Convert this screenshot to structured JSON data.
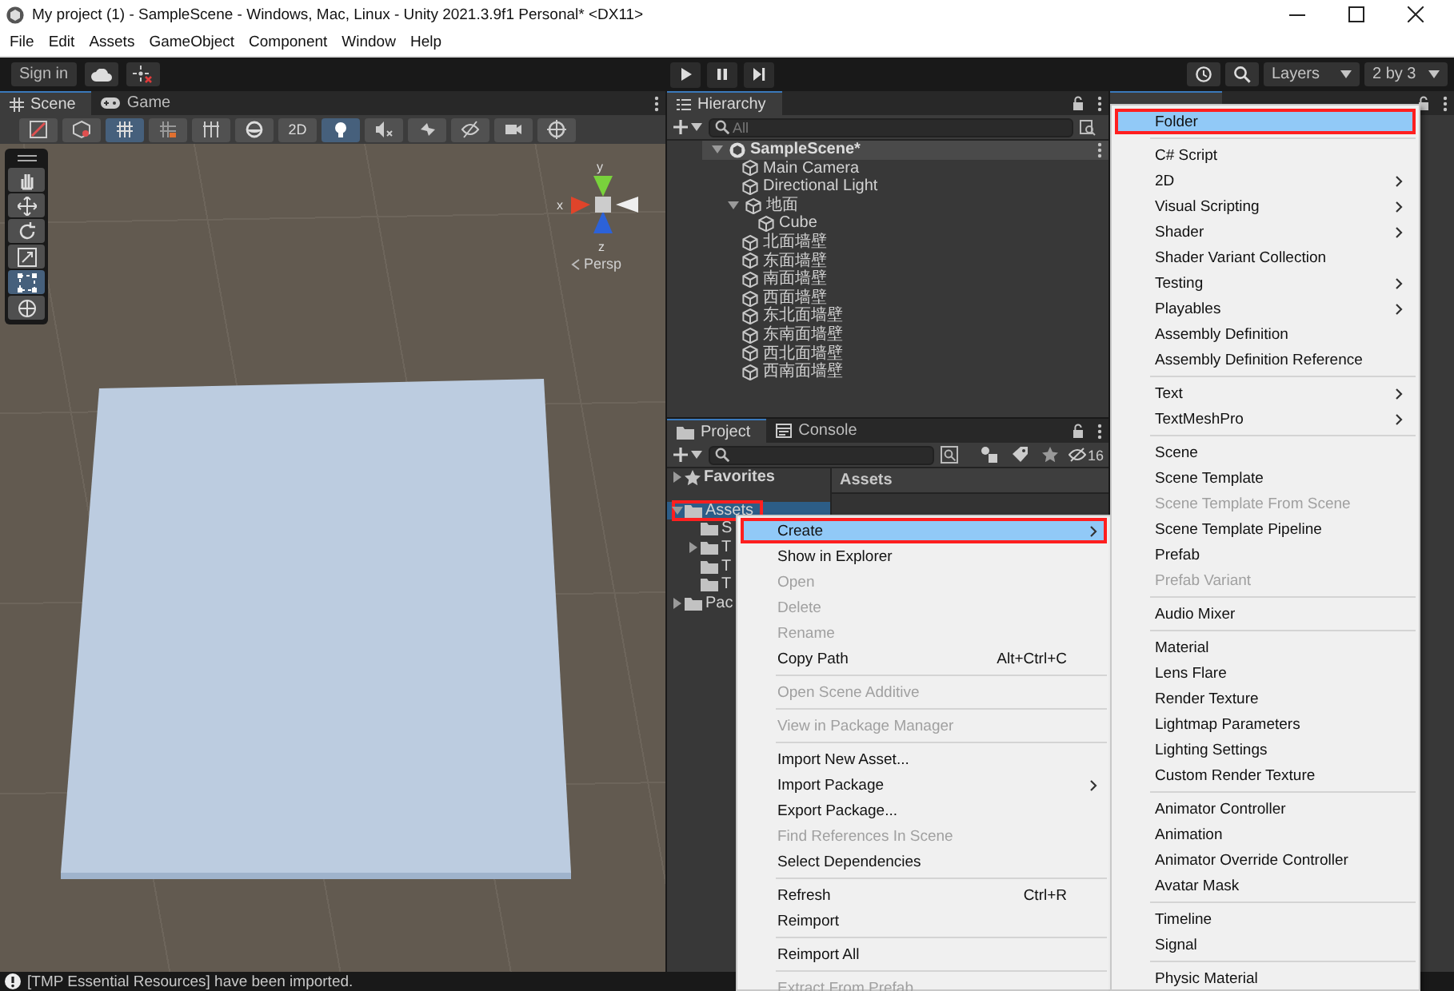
{
  "window": {
    "title": "My project (1) - SampleScene - Windows, Mac, Linux - Unity 2021.3.9f1 Personal* <DX11>"
  },
  "menu_bar": [
    "File",
    "Edit",
    "Assets",
    "GameObject",
    "Component",
    "Window",
    "Help"
  ],
  "toolbar": {
    "sign_in": "Sign in",
    "layers": "Layers",
    "layout": "2 by 3"
  },
  "scene_view": {
    "tabs": [
      {
        "label": "Scene",
        "kind": "scene",
        "selected": true
      },
      {
        "label": "Game",
        "kind": "game",
        "selected": false
      }
    ],
    "toggles": [
      {
        "kind": "draw-mode",
        "selected": false
      },
      {
        "kind": "render",
        "selected": false
      },
      {
        "kind": "grid",
        "selected": true
      },
      {
        "kind": "snap",
        "selected": false
      },
      {
        "kind": "increment",
        "selected": false
      },
      {
        "kind": "orbit",
        "selected": false
      },
      {
        "kind": "text",
        "label": "2D",
        "selected": false
      },
      {
        "kind": "light",
        "selected": true
      },
      {
        "kind": "audio",
        "selected": false
      },
      {
        "kind": "effects",
        "selected": false
      },
      {
        "kind": "hidden",
        "selected": false
      },
      {
        "kind": "camera",
        "selected": false
      },
      {
        "kind": "gizmos",
        "selected": false
      }
    ],
    "tools": [
      {
        "kind": "hand",
        "selected": false
      },
      {
        "kind": "move",
        "selected": false
      },
      {
        "kind": "rotate",
        "selected": false
      },
      {
        "kind": "scale",
        "selected": false
      },
      {
        "kind": "rect",
        "selected": true
      },
      {
        "kind": "transform",
        "selected": false
      }
    ],
    "gizmo": {
      "y": "y",
      "x": "x",
      "z": "z",
      "projection": "Persp"
    }
  },
  "hierarchy": {
    "title": "Hierarchy",
    "search_placeholder": "All",
    "scene": {
      "label": "SampleScene*",
      "expanded": true,
      "children": [
        {
          "label": "Main Camera"
        },
        {
          "label": "Directional Light"
        },
        {
          "label": "地面",
          "expanded": true,
          "children": [
            {
              "label": "Cube"
            }
          ]
        },
        {
          "label": "北面墙壁"
        },
        {
          "label": "东面墙壁"
        },
        {
          "label": "南面墙壁"
        },
        {
          "label": "西面墙壁"
        },
        {
          "label": "东北面墙壁"
        },
        {
          "label": "东南面墙壁"
        },
        {
          "label": "西北面墙壁"
        },
        {
          "label": "西南面墙壁"
        }
      ]
    }
  },
  "project": {
    "tabs": [
      {
        "label": "Project",
        "kind": "project",
        "selected": true
      },
      {
        "label": "Console",
        "kind": "console",
        "selected": false
      }
    ],
    "hidden_count": "16",
    "pane_header": "Assets",
    "tree": [
      {
        "label": "Favorites",
        "kind": "favorites",
        "expanded": false,
        "selected": false
      },
      {
        "label": "Assets",
        "kind": "folder",
        "expanded": true,
        "selected": true,
        "outlined": true,
        "children": [
          {
            "label": "S",
            "kind": "folder",
            "selected": false
          },
          {
            "label": "T",
            "kind": "folder",
            "expanded": false,
            "selected": false
          },
          {
            "label": "T",
            "kind": "folder",
            "selected": false
          },
          {
            "label": "T",
            "kind": "folder",
            "selected": false
          }
        ]
      },
      {
        "label": "Pac",
        "kind": "folder",
        "expanded": false,
        "selected": false
      }
    ]
  },
  "context_menu": {
    "items": [
      {
        "kind": "item",
        "label": "Create",
        "selected": true,
        "outlined": true,
        "submenu": true
      },
      {
        "kind": "item",
        "label": "Show in Explorer",
        "selected": false
      },
      {
        "kind": "item",
        "label": "Open",
        "selected": false,
        "disabled": true
      },
      {
        "kind": "item",
        "label": "Delete",
        "selected": false,
        "disabled": true
      },
      {
        "kind": "item",
        "label": "Rename",
        "selected": false,
        "disabled": true
      },
      {
        "kind": "item",
        "label": "Copy Path",
        "selected": false,
        "shortcut": "Alt+Ctrl+C"
      },
      {
        "kind": "separator"
      },
      {
        "kind": "item",
        "label": "Open Scene Additive",
        "selected": false,
        "disabled": true
      },
      {
        "kind": "separator"
      },
      {
        "kind": "item",
        "label": "View in Package Manager",
        "selected": false,
        "disabled": true
      },
      {
        "kind": "separator"
      },
      {
        "kind": "item",
        "label": "Import New Asset...",
        "selected": false
      },
      {
        "kind": "item",
        "label": "Import Package",
        "selected": false,
        "submenu": true
      },
      {
        "kind": "item",
        "label": "Export Package...",
        "selected": false
      },
      {
        "kind": "item",
        "label": "Find References In Scene",
        "selected": false,
        "disabled": true
      },
      {
        "kind": "item",
        "label": "Select Dependencies",
        "selected": false
      },
      {
        "kind": "separator"
      },
      {
        "kind": "item",
        "label": "Refresh",
        "selected": false,
        "shortcut": "Ctrl+R"
      },
      {
        "kind": "item",
        "label": "Reimport",
        "selected": false
      },
      {
        "kind": "separator"
      },
      {
        "kind": "item",
        "label": "Reimport All",
        "selected": false
      },
      {
        "kind": "separator"
      },
      {
        "kind": "item",
        "label": "Extract From Prefab",
        "selected": false,
        "disabled": true
      }
    ]
  },
  "create_submenu": {
    "items": [
      {
        "kind": "item",
        "label": "Folder",
        "selected": true,
        "outlined": true
      },
      {
        "kind": "separator"
      },
      {
        "kind": "item",
        "label": "C# Script",
        "selected": false
      },
      {
        "kind": "item",
        "label": "2D",
        "selected": false,
        "submenu": true
      },
      {
        "kind": "item",
        "label": "Visual Scripting",
        "selected": false,
        "submenu": true
      },
      {
        "kind": "item",
        "label": "Shader",
        "selected": false,
        "submenu": true
      },
      {
        "kind": "item",
        "label": "Shader Variant Collection",
        "selected": false
      },
      {
        "kind": "item",
        "label": "Testing",
        "selected": false,
        "submenu": true
      },
      {
        "kind": "item",
        "label": "Playables",
        "selected": false,
        "submenu": true
      },
      {
        "kind": "item",
        "label": "Assembly Definition",
        "selected": false
      },
      {
        "kind": "item",
        "label": "Assembly Definition Reference",
        "selected": false
      },
      {
        "kind": "separator"
      },
      {
        "kind": "item",
        "label": "Text",
        "selected": false,
        "submenu": true
      },
      {
        "kind": "item",
        "label": "TextMeshPro",
        "selected": false,
        "submenu": true
      },
      {
        "kind": "separator"
      },
      {
        "kind": "item",
        "label": "Scene",
        "selected": false
      },
      {
        "kind": "item",
        "label": "Scene Template",
        "selected": false
      },
      {
        "kind": "item",
        "label": "Scene Template From Scene",
        "selected": false,
        "disabled": true
      },
      {
        "kind": "item",
        "label": "Scene Template Pipeline",
        "selected": false
      },
      {
        "kind": "item",
        "label": "Prefab",
        "selected": false
      },
      {
        "kind": "item",
        "label": "Prefab Variant",
        "selected": false,
        "disabled": true
      },
      {
        "kind": "separator"
      },
      {
        "kind": "item",
        "label": "Audio Mixer",
        "selected": false
      },
      {
        "kind": "separator"
      },
      {
        "kind": "item",
        "label": "Material",
        "selected": false
      },
      {
        "kind": "item",
        "label": "Lens Flare",
        "selected": false
      },
      {
        "kind": "item",
        "label": "Render Texture",
        "selected": false
      },
      {
        "kind": "item",
        "label": "Lightmap Parameters",
        "selected": false
      },
      {
        "kind": "item",
        "label": "Lighting Settings",
        "selected": false
      },
      {
        "kind": "item",
        "label": "Custom Render Texture",
        "selected": false
      },
      {
        "kind": "separator"
      },
      {
        "kind": "item",
        "label": "Animator Controller",
        "selected": false
      },
      {
        "kind": "item",
        "label": "Animation",
        "selected": false
      },
      {
        "kind": "item",
        "label": "Animator Override Controller",
        "selected": false
      },
      {
        "kind": "item",
        "label": "Avatar Mask",
        "selected": false
      },
      {
        "kind": "separator"
      },
      {
        "kind": "item",
        "label": "Timeline",
        "selected": false
      },
      {
        "kind": "item",
        "label": "Signal",
        "selected": false
      },
      {
        "kind": "separator"
      },
      {
        "kind": "item",
        "label": "Physic Material",
        "selected": false
      }
    ]
  },
  "status_bar": {
    "message": "[TMP Essential Resources] have been imported."
  }
}
